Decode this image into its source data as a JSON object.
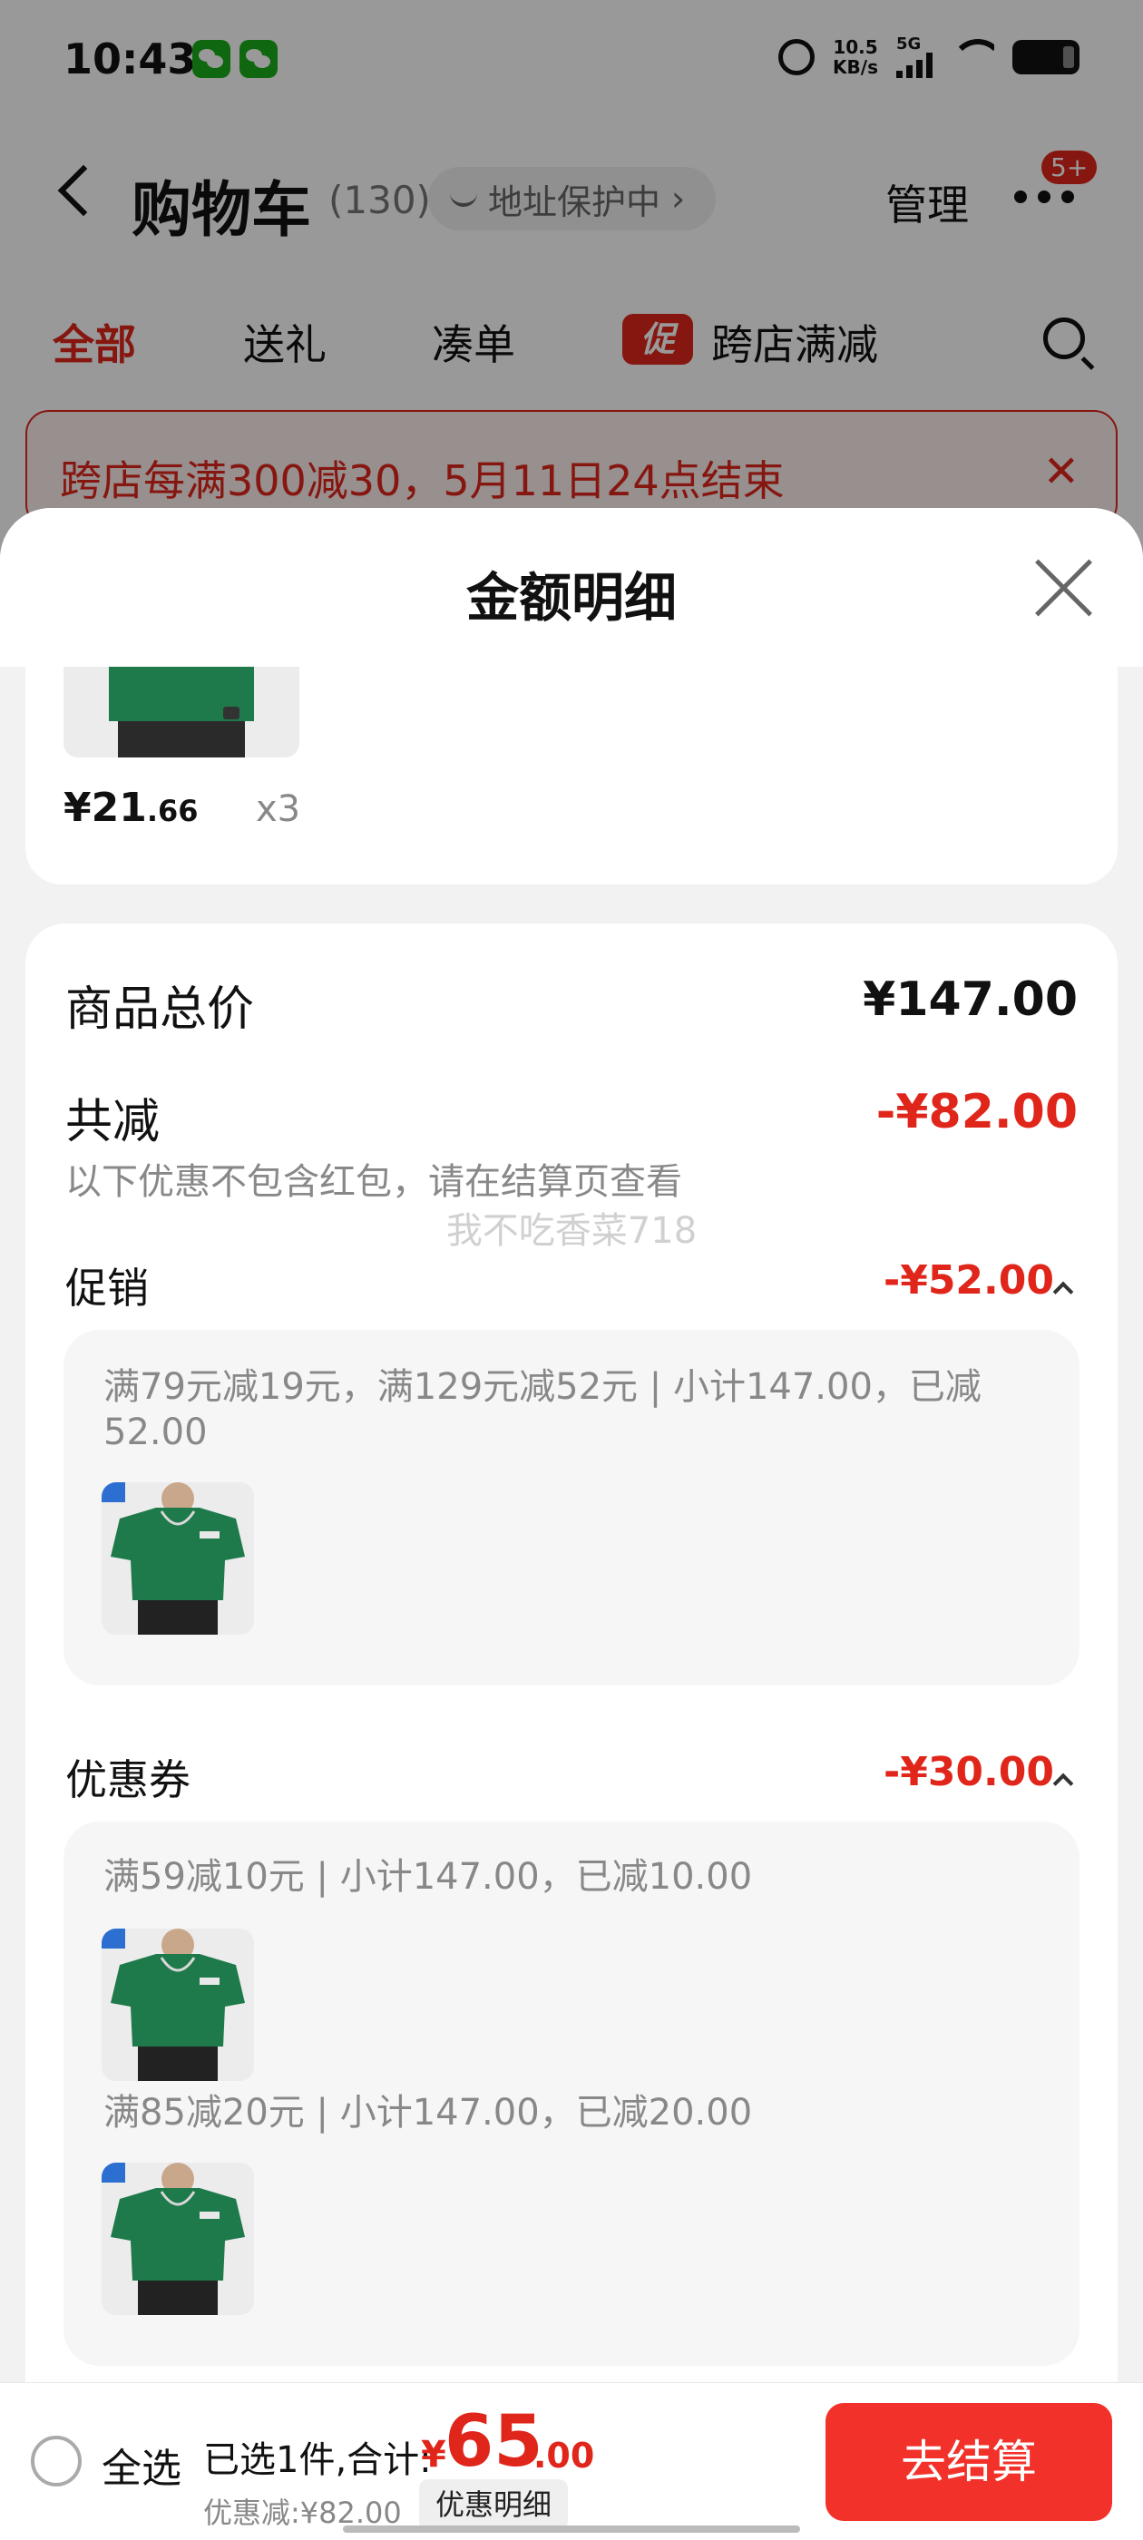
{
  "status_bar": {
    "time": "10:43",
    "net_speed_value": "10.5",
    "net_speed_unit": "KB/s",
    "network": "5G"
  },
  "nav": {
    "title": "购物车",
    "count": "(130)",
    "address_protect": "地址保护中",
    "address_chevron": "›",
    "manage": "管理",
    "badge": "5+"
  },
  "tabs": [
    "全部",
    "送礼",
    "凑单",
    "跨店满减"
  ],
  "promo_tag": "促",
  "banner": {
    "text": "跨店每满300减30，5月11日24点结束",
    "close": "✕"
  },
  "sheet": {
    "title": "金额明细",
    "top_item": {
      "price_int": "¥21",
      "price_dec": ".66",
      "qty": "x3"
    },
    "total_label": "商品总价",
    "total_amount": "¥147.00",
    "reduce_label": "共减",
    "reduce_amount": "-¥82.00",
    "reduce_note": "以下优惠不包含红包，请在结算页查看",
    "watermark": "我不吃香菜718",
    "promo": {
      "label": "促销",
      "amount": "-¥52.00",
      "line": "满79元减19元，满129元减52元 | 小计147.00，已减52.00"
    },
    "coupon": {
      "label": "优惠券",
      "amount": "-¥30.00",
      "line1": "满59减10元 | 小计147.00，已减10.00",
      "line2": "满85减20元 | 小计147.00，已减20.00"
    }
  },
  "bottom": {
    "select_all": "全选",
    "selected_summary": "已选1件,合计:",
    "total_yen": "¥",
    "total_int": "65",
    "total_dec": ".00",
    "discount": "优惠减:¥82.00",
    "detail_chip": "优惠明细",
    "checkout": "去结算"
  },
  "colors": {
    "accent": "#e0261b",
    "checkout": "#f2322a",
    "product_green": "#1e7a4a"
  }
}
